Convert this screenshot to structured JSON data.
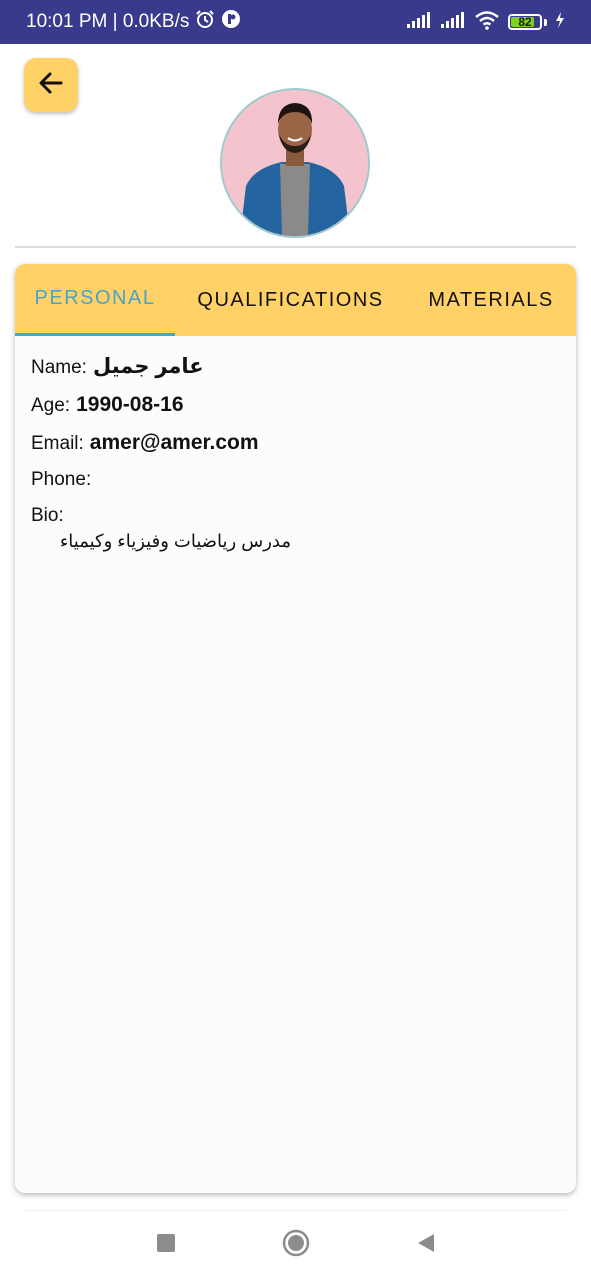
{
  "status_bar": {
    "time_speed": "10:01 PM | 0.0KB/s",
    "battery_level": "82",
    "battery_fraction": 0.82,
    "battery_color": "#7ed321",
    "bg_color": "#3a3a8c"
  },
  "header": {
    "back_icon": "arrow-left-icon",
    "avatar_icon": "profile-photo"
  },
  "tabs": [
    {
      "label": "PERSONAL",
      "active": true
    },
    {
      "label": "QUALIFICATIONS",
      "active": false
    },
    {
      "label": "MATERIALS",
      "active": false
    }
  ],
  "personal": {
    "name_label": "Name:",
    "name_value": "عامر جميل",
    "age_label": "Age:",
    "age_value": "1990-08-16",
    "email_label": "Email:",
    "email_value": "amer@amer.com",
    "phone_label": "Phone:",
    "phone_value": "",
    "bio_label": "Bio:",
    "bio_value": "مدرس رياضيات وفيزياء وكيمياء"
  },
  "colors": {
    "accent_yellow": "#ffd166",
    "active_tab": "#4aa3c8"
  },
  "nav_bar": {
    "recents_icon": "square-icon",
    "home_icon": "circle-home-icon",
    "back_icon": "triangle-back-icon"
  }
}
